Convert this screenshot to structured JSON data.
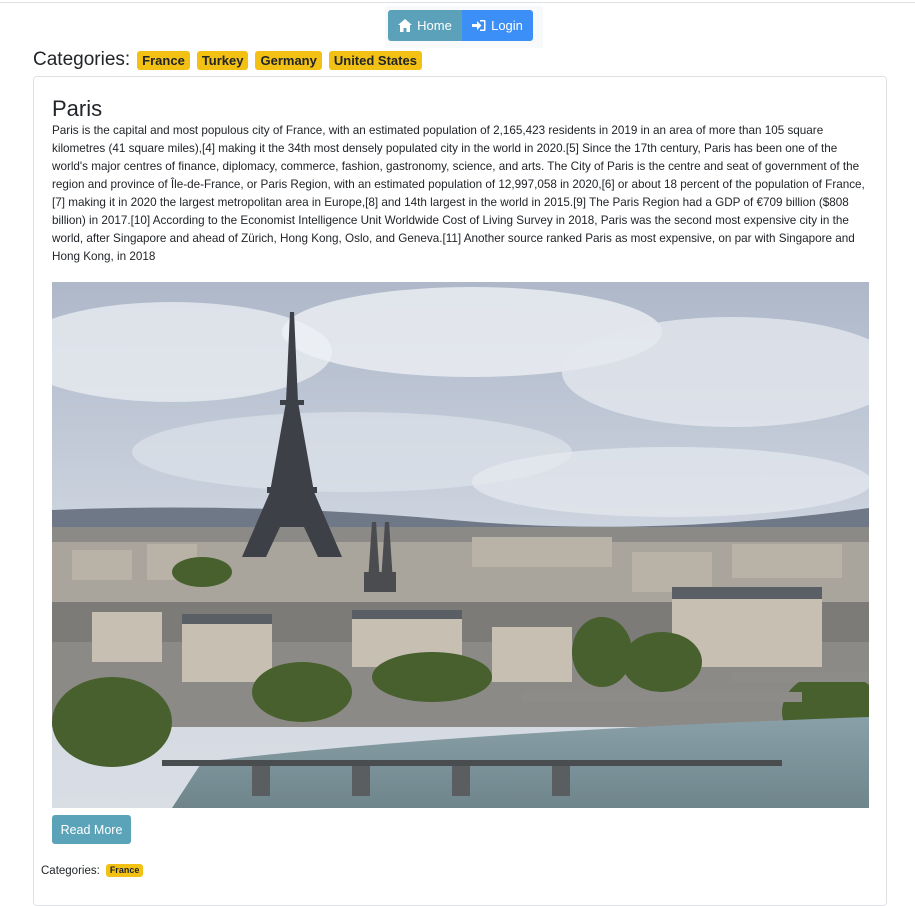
{
  "nav": {
    "home_label": "Home",
    "login_label": "Login",
    "home_icon": "home-icon",
    "login_icon": "sign-in-icon",
    "home_color": "#5aa1b9",
    "login_color": "#3b8ff7"
  },
  "categories": {
    "label": "Categories:",
    "items": [
      "France",
      "Turkey",
      "Germany",
      "United States"
    ],
    "badge_color": "#f2c114"
  },
  "article": {
    "title": "Paris",
    "body": "Paris is the capital and most populous city of France, with an estimated population of 2,165,423 residents in 2019 in an area of more than 105 square kilometres (41 square miles),[4] making it the 34th most densely populated city in the world in 2020.[5] Since the 17th century, Paris has been one of the world's major centres of finance, diplomacy, commerce, fashion, gastronomy, science, and arts. The City of Paris is the centre and seat of government of the region and province of Île-de-France, or Paris Region, with an estimated population of 12,997,058 in 2020,[6] or about 18 percent of the population of France,[7] making it in 2020 the largest metropolitan area in Europe,[8] and 14th largest in the world in 2015.[9] The Paris Region had a GDP of €709 billion ($808 billion) in 2017.[10] According to the Economist Intelligence Unit Worldwide Cost of Living Survey in 2018, Paris was the second most expensive city in the world, after Singapore and ahead of Zürich, Hong Kong, Oslo, and Geneva.[11] Another source ranked Paris as most expensive, on par with Singapore and Hong Kong, in 2018",
    "read_more_label": "Read More",
    "footer_categories_label": "Categories:",
    "footer_categories": [
      "France"
    ]
  }
}
